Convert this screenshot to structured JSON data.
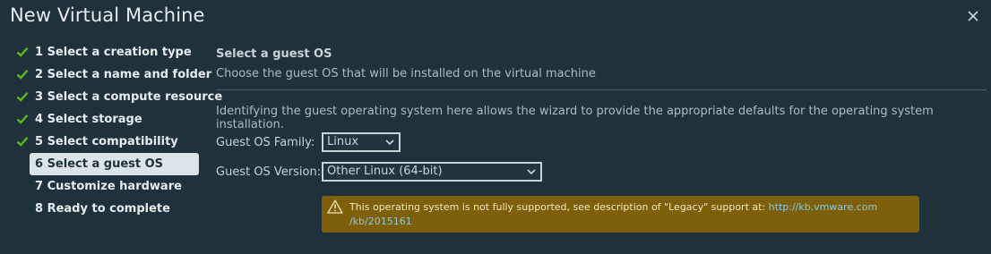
{
  "dialog": {
    "title": "New Virtual Machine"
  },
  "steps": [
    {
      "label": "1 Select a creation type",
      "status": "completed"
    },
    {
      "label": "2 Select a name and folder",
      "status": "completed"
    },
    {
      "label": "3 Select a compute resource",
      "status": "completed"
    },
    {
      "label": "4 Select storage",
      "status": "completed"
    },
    {
      "label": "5 Select compatibility",
      "status": "completed"
    },
    {
      "label": "6 Select a guest OS",
      "status": "active"
    },
    {
      "label": "7 Customize hardware",
      "status": "pending"
    },
    {
      "label": "8 Ready to complete",
      "status": "pending"
    }
  ],
  "main": {
    "heading": "Select a guest OS",
    "subheading": "Choose the guest OS that will be installed on the virtual machine",
    "description": "Identifying the guest operating system here allows the wizard to provide the appropriate defaults for the operating system installation.",
    "os_family": {
      "label": "Guest OS Family:",
      "value": "Linux"
    },
    "os_version": {
      "label": "Guest OS Version:",
      "value": "Other Linux (64-bit)"
    },
    "alert": {
      "text": "This operating system is not fully supported, see description of \"Legacy\" support at:",
      "link_line1": "http://kb.vmware.com",
      "link_line2": "/kb/2015161"
    }
  },
  "colors": {
    "background": "#1f313b",
    "check": "#5eb715",
    "active_step_bg": "#dbe4e9",
    "warning_bg": "#7d6009",
    "link": "#86c8e8"
  },
  "icons": {
    "close": "close-icon",
    "check": "check-icon",
    "dropdown": "chevron-down-icon",
    "warning": "warning-triangle-icon"
  }
}
